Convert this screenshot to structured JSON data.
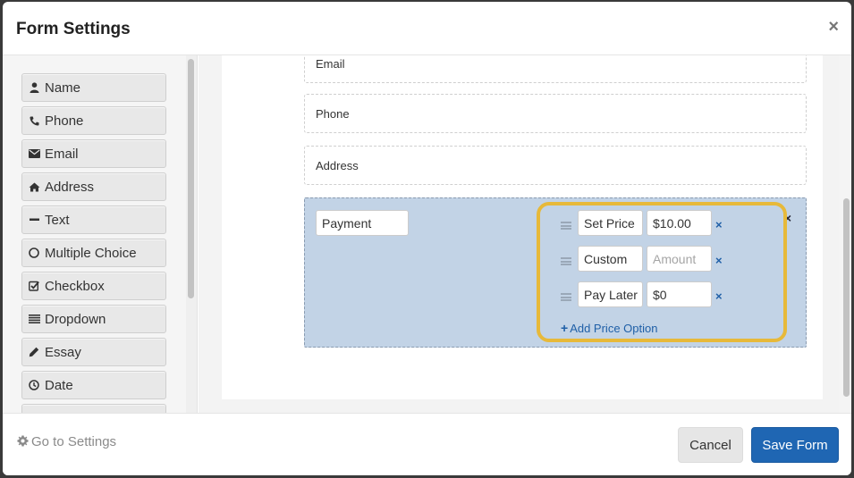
{
  "modal": {
    "title": "Form Settings",
    "close_glyph": "×"
  },
  "sidebar": {
    "items": [
      {
        "label": "Name",
        "icon": "user-icon"
      },
      {
        "label": "Phone",
        "icon": "phone-icon"
      },
      {
        "label": "Email",
        "icon": "envelope-icon"
      },
      {
        "label": "Address",
        "icon": "home-icon"
      },
      {
        "label": "Text",
        "icon": "minus-icon"
      },
      {
        "label": "Multiple Choice",
        "icon": "radio-icon"
      },
      {
        "label": "Checkbox",
        "icon": "checkbox-icon"
      },
      {
        "label": "Dropdown",
        "icon": "list-icon"
      },
      {
        "label": "Essay",
        "icon": "pencil-icon"
      },
      {
        "label": "Date",
        "icon": "clock-icon"
      }
    ]
  },
  "form": {
    "fields": [
      "Email",
      "Phone",
      "Address"
    ],
    "payment": {
      "label": "Payment",
      "remove_glyph": "×",
      "options": [
        {
          "name": "Set Price",
          "amount": "$10.00",
          "amount_placeholder": ""
        },
        {
          "name": "Custom",
          "amount": "",
          "amount_placeholder": "Amount"
        },
        {
          "name": "Pay Later",
          "amount": "$0",
          "amount_placeholder": ""
        }
      ],
      "option_remove_glyph": "×",
      "add_label": "Add Price Option",
      "add_glyph": "+",
      "highlight_color": "#e7b93a"
    }
  },
  "footer": {
    "goto_label": "Go to Settings",
    "goto_icon": "gear-icon",
    "cancel_label": "Cancel",
    "save_label": "Save Form",
    "primary_color": "#1f66b3"
  }
}
